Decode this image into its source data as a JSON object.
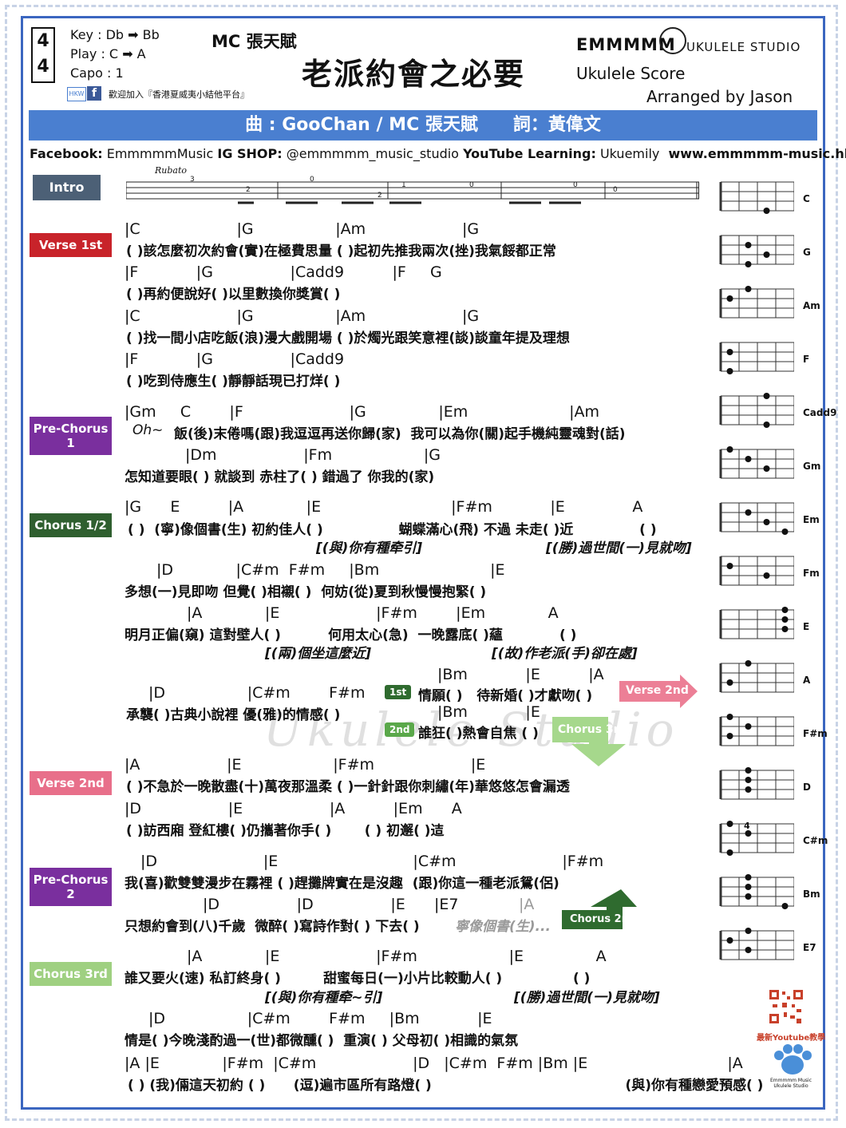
{
  "header": {
    "time_top": "4",
    "time_bottom": "4",
    "key": "Key : Db ➡ Bb",
    "play": "Play : C ➡ A",
    "capo": "Capo : 1",
    "welcome": "歡迎加入『香港夏威夷小結他平台』",
    "singer": "MC 張天賦",
    "title": "老派約會之必要",
    "brand": "EMMMMM",
    "studio": "UKULELE STUDIO",
    "score": "Ukulele Score",
    "arranger": "Arranged by Jason",
    "credit": "曲 : GooChan / MC 張天賦　　詞：黃偉文",
    "links": {
      "fb_label": "Facebook:",
      "fb": "EmmmmmMusic",
      "ig_label": "IG SHOP:",
      "ig": "@emmmmm_music_studio",
      "yt_label": "YouTube Learning:",
      "yt": "Ukuemily",
      "site": "www.emmmmm-music.hk"
    },
    "rubato": "Rubato"
  },
  "sections": {
    "intro": "Intro",
    "verse1": "Verse 1st",
    "prechorus1": "Pre-Chorus 1",
    "chorus12": "Chorus 1/2",
    "verse2": "Verse 2nd",
    "prechorus2": "Pre-Chorus 2",
    "chorus3": "Chorus 3rd"
  },
  "lines": {
    "v1c1": "|C                    |G                 |Am                    |G",
    "v1l1": "( )該怎麼初次約會(實)在極費思量 ( )起初先推我兩次(挫)我氣餒都正常",
    "v1c2": "|F            |G                |Cadd9          |F     G",
    "v1l2": "( )再約便說好( )以里數換你獎賞( )",
    "v1c3": "|C                    |G                 |Am                    |G",
    "v1l3": "( )找一間小店吃飯(浪)漫大戲開場 ( )於燭光跟笑意裡(談)談童年提及理想",
    "v1c4": "|F            |G                |Cadd9",
    "v1l4": "( )吃到侍應生( )靜靜話現已打烊( )",
    "p1c1": "|Gm     C        |F                      |G               |Em                     |Am",
    "p1oh": "Oh~",
    "p1l1": "飯(後)末倦嗎(跟)我逗逗再送你歸(家)  我可以為你(關)起手機純靈魂對(話)",
    "p1c2": "|Dm                  |Fm                   |G",
    "p1l2": "怎知道要眼( ) 就談到 赤柱了( ) 錯過了 你我的(家)",
    "c1c1": "|G      E          |A             |E                           |F#m            |E              A",
    "c1l1": "( )  (寧)像個書(生) 初約佳人( )                蝴蝶滿心(飛) 不過 未走( )近              ( )",
    "c1e1": "[(與)你有種牵引]",
    "c1e2": "[(勝)過世間(一)見就吻]",
    "c1c2": "|D             |C#m  F#m     |Bm                       |E",
    "c1l2": "多想(一)見即吻 但覺( )相襯( )  何妨(從)夏到秋慢慢抱緊( )",
    "c1c3": "|A             |E                    |F#m        |Em             A",
    "c1l3": "明月正偏(窺) 這對壁人( )          何用太心(急)  一晚露底( )蘊            ( )",
    "c1e3": "[(兩)個坐這麼近]",
    "c1e4": "[(故)作老派(手)卻在處]",
    "c1c4a": "|Bm            |E          |A",
    "c1c4": "|D                 |C#m        F#m",
    "c1l4": "承襲( )古典小說裡 優(雅)的情感( )",
    "first": "1st",
    "c1l4a": "情願( )   待新婚( )才獻吻( )",
    "c1c4b": "|Bm            |E",
    "second": "2nd",
    "c1l4b": "誰狂( )熱會自焦 ( )",
    "goto_v2": "Verse 2nd",
    "goto_c3": "Chorus 3rd",
    "v2c1": "|A                  |E                   |F#m                    |E",
    "v2l1": "( )不急於一晚散盡(十)萬夜那溫柔 ( )一針針跟你刺繡(年)華悠悠怎會漏透",
    "v2c2": "|D                  |E                  |A          |Em      A",
    "v2l2": "( )訪西廂 登紅樓( )仍攜著你手( )       ( ) 初邂( )迼",
    "p2c1": "|D                      |E                            |C#m                      |F#m",
    "p2l1": "我(喜)歡雙雙漫步在霧裡 ( )趕攤牌實在是沒趣  (跟)你這一種老派鴛(侶)",
    "p2c2": "|D                |D                |E      |E7",
    "p2c2g": "|A",
    "p2l2": "只想約會到(八)千歲  微醉( )寫詩作對( ) 下去( )",
    "p2l2g": "寧像個書(生)...",
    "goto_c2": "Chorus 2nd",
    "c3c1": "|A             |E                    |F#m                   |E               A",
    "c3l1": "誰又要火(速) 私訂終身( )         甜蜜每日(一)小片比較動人( )               ( )",
    "c3e1": "[(與)你有種牵~引]",
    "c3e2": "[(勝)過世間(一)見就吻]",
    "c3c2": "|D                 |C#m        F#m     |Bm            |E",
    "c3l2": "情是( )今晚淺酌過一(世)都微醺( )  重演( ) 父母初( )相識的氣氛",
    "c3c3": "|A |E             |F#m  |C#m                    |D   |C#m  F#m |Bm |E                             |A",
    "c3l3": "( ) (我)倆這天初約 ( )      (逗)遍市區所有路燈( )                                         (與)你有種戀愛預感( )"
  },
  "chords": {
    "list": [
      "C",
      "G",
      "Am",
      "F",
      "Cadd9",
      "Gm",
      "Em",
      "Fm",
      "E",
      "A",
      "F#m",
      "D",
      "C#m",
      "Bm",
      "E7"
    ],
    "fret4": "4",
    "fret3": "3"
  },
  "footer": {
    "qr_caption": "最新Youtube教學",
    "logo_text": "Emmmmm Music Ukulele Studio"
  },
  "watermark": "Ukulele Studio",
  "colors": {
    "blue": "#4a7fd0",
    "verse1": "#c8232a",
    "prechorus": "#7a2f9e",
    "chorus": "#2f5f2f",
    "verse2": "#e86f8a",
    "chorus3": "#9fd081",
    "intro": "#4c6076"
  }
}
